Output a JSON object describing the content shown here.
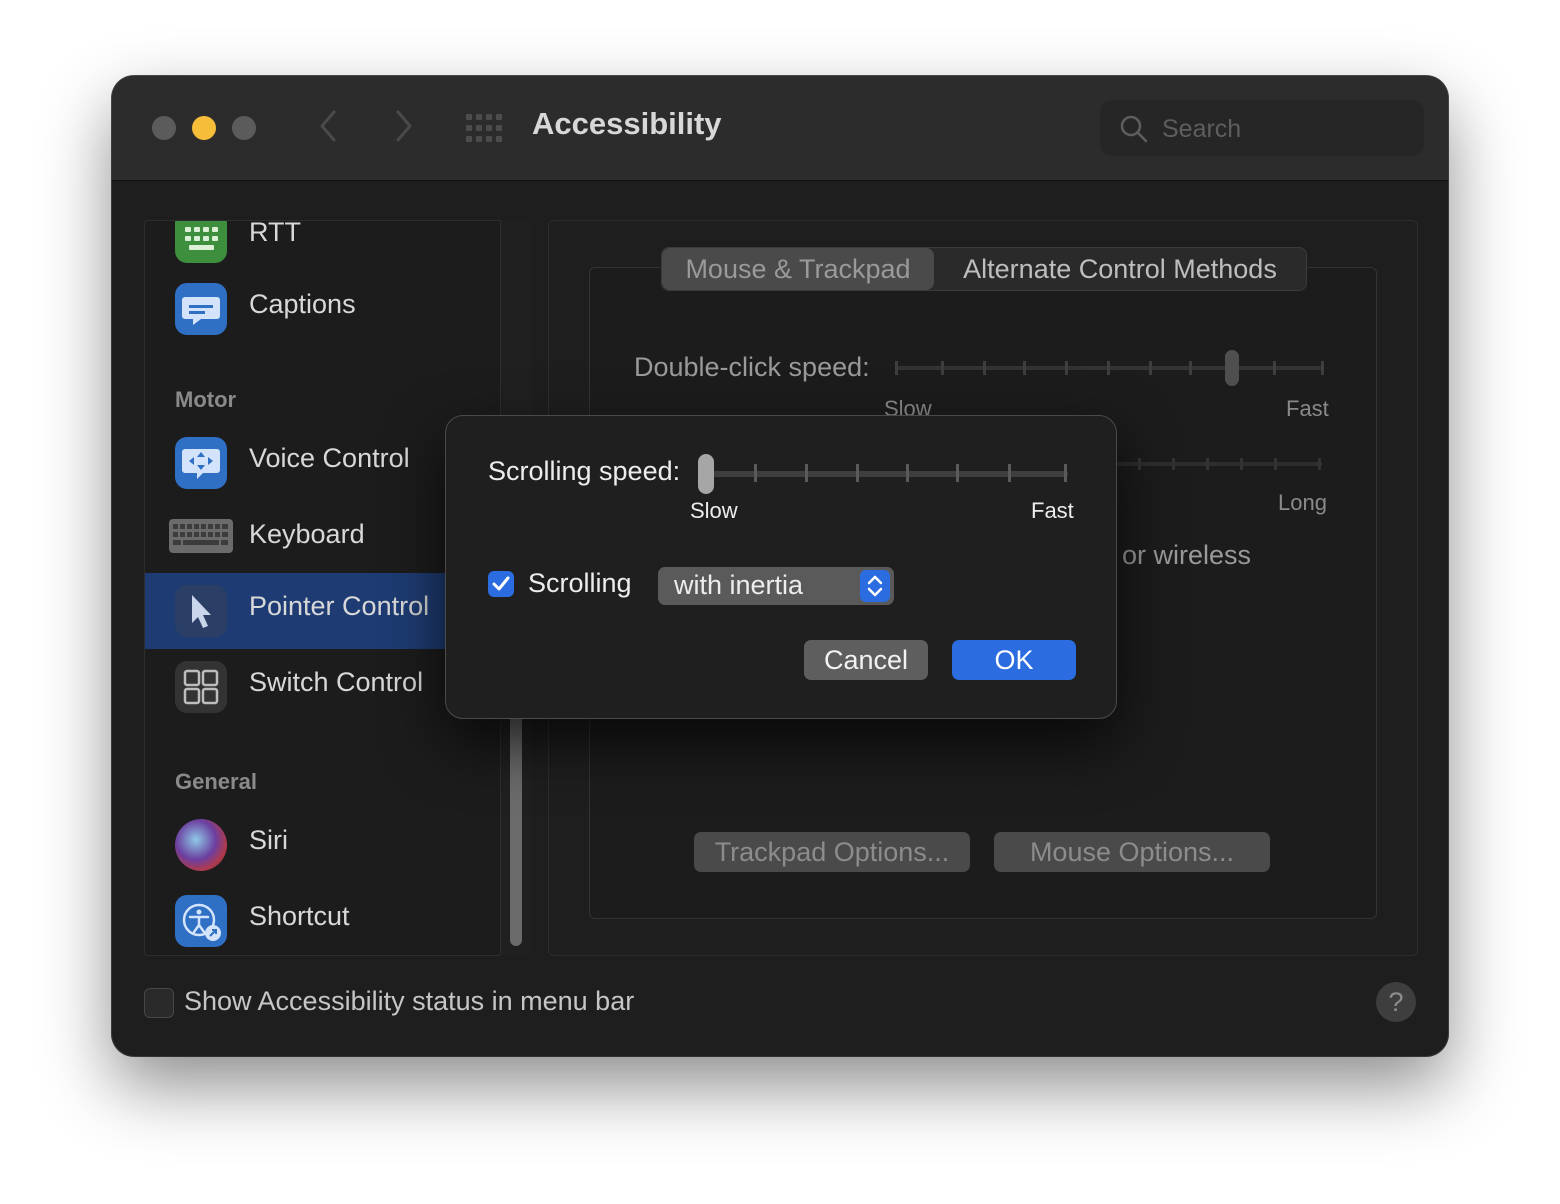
{
  "window": {
    "title": "Accessibility",
    "search_placeholder": "Search"
  },
  "sidebar": {
    "items": [
      {
        "label": "RTT",
        "icon": "rtt-keyboard-icon"
      },
      {
        "label": "Captions",
        "icon": "captions-icon"
      },
      {
        "label": "Voice Control",
        "icon": "voice-control-icon"
      },
      {
        "label": "Keyboard",
        "icon": "keyboard-icon"
      },
      {
        "label": "Pointer Control",
        "icon": "pointer-icon",
        "selected": true
      },
      {
        "label": "Switch Control",
        "icon": "switch-control-icon"
      },
      {
        "label": "Siri",
        "icon": "siri-icon"
      },
      {
        "label": "Shortcut",
        "icon": "accessibility-shortcut-icon"
      }
    ],
    "sections": {
      "motor": "Motor",
      "general": "General"
    }
  },
  "main": {
    "tabs": [
      {
        "label": "Mouse & Trackpad",
        "active": true
      },
      {
        "label": "Alternate Control Methods",
        "active": false
      }
    ],
    "double_click_speed_label": "Double-click speed:",
    "double_click_slow": "Slow",
    "double_click_fast": "Fast",
    "spring_long": "Long",
    "wireless_text": "or wireless",
    "trackpad_options_label": "Trackpad Options...",
    "mouse_options_label": "Mouse Options..."
  },
  "footer": {
    "status_label": "Show Accessibility status in menu bar",
    "status_checked": false,
    "help_label": "?"
  },
  "dialog": {
    "scrolling_speed_label": "Scrolling speed:",
    "scrolling_speed_value": 0,
    "slow_label": "Slow",
    "fast_label": "Fast",
    "scrolling_checkbox_label": "Scrolling",
    "scrolling_checked": true,
    "scrolling_mode": "with inertia",
    "cancel_label": "Cancel",
    "ok_label": "OK"
  },
  "colors": {
    "accent": "#2b6ce0",
    "selected_row": "#1e3c73",
    "traffic_light_minimize": "#f6bd3b"
  }
}
